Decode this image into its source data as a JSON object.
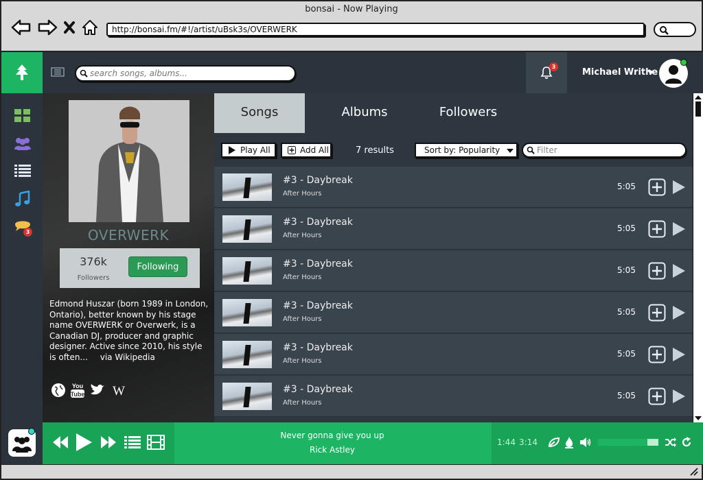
{
  "browser": {
    "title": "bonsai - Now Playing",
    "url": "http://bonsai.fm/#!/artist/uBsk3s/OVERWERK"
  },
  "topbar": {
    "search_placeholder": "search songs, albums...",
    "notification_count": "3",
    "user_name": "Michael Writhe"
  },
  "sidebar": {
    "items": [
      {
        "icon": "grid-icon"
      },
      {
        "icon": "users-icon"
      },
      {
        "icon": "list-icon"
      },
      {
        "icon": "music-note-icon"
      },
      {
        "icon": "chat-icon",
        "badge": "3"
      }
    ]
  },
  "artist": {
    "name": "OVERWERK",
    "followers_count": "376k",
    "followers_label": "Followers",
    "follow_button": "Following",
    "bio": "Edmond Huszar (born 1989 in London, Ontario), better known by his stage name OVERWERK or Overwerk, is a Canadian DJ, producer and graphic designer. Active since 2010, his style is often...",
    "bio_source": "via Wikipedia"
  },
  "main": {
    "tabs": [
      {
        "label": "Songs",
        "active": true
      },
      {
        "label": "Albums",
        "active": false
      },
      {
        "label": "Followers",
        "active": false
      }
    ],
    "play_all_label": "Play All",
    "add_all_label": "Add All",
    "results": "7 results",
    "sort_label": "Sort by: Popularity",
    "filter_placeholder": "Filter",
    "songs": [
      {
        "title": "#3 - Daybreak",
        "album": "After Hours",
        "duration": "5:05"
      },
      {
        "title": "#3 - Daybreak",
        "album": "After Hours",
        "duration": "5:05"
      },
      {
        "title": "#3 - Daybreak",
        "album": "After Hours",
        "duration": "5:05"
      },
      {
        "title": "#3 - Daybreak",
        "album": "After Hours",
        "duration": "5:05"
      },
      {
        "title": "#3 - Daybreak",
        "album": "After Hours",
        "duration": "5:05"
      },
      {
        "title": "#3 - Daybreak",
        "album": "After Hours",
        "duration": "5:05"
      }
    ]
  },
  "player": {
    "song": "Never gonna give you up",
    "artist": "Rick Astley",
    "elapsed": "1:44",
    "total": "3:14",
    "volume_fraction": 0.82
  },
  "colors": {
    "brand_green": "#1db563",
    "dark_bg": "#2e373f",
    "badge_red": "#d9332d"
  }
}
